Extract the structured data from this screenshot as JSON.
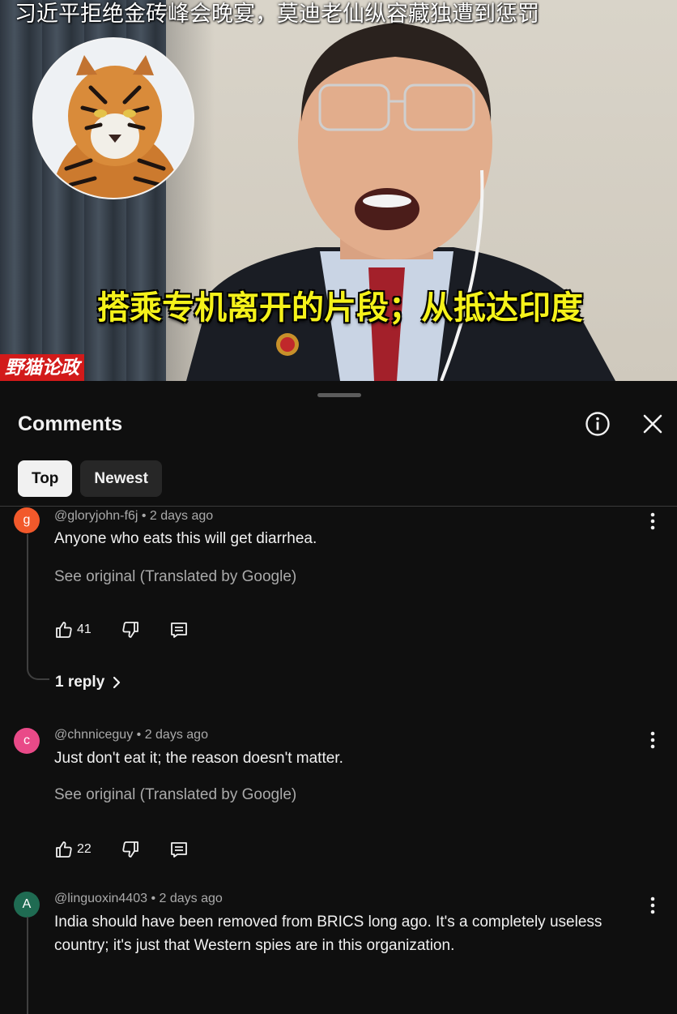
{
  "video": {
    "title": "习近平拒绝金砖峰会晚宴，莫迪老仙纵容藏独遭到惩罚",
    "subtitle": "搭乘专机离开的片段；从抵达印度",
    "channel_tag": "野猫论政",
    "avatar": "tiger-photo"
  },
  "sheet": {
    "title": "Comments",
    "info_icon": "info-icon",
    "close_icon": "close-icon",
    "chips": [
      {
        "label": "Top",
        "active": true
      },
      {
        "label": "Newest",
        "active": false
      }
    ]
  },
  "comments": [
    {
      "avatar_letter": "g",
      "avatar_color": "#f2592b",
      "author": "@gloryjohn-f6j",
      "time": "2 days ago",
      "text": "Anyone who eats this will get diarrhea.",
      "translation": "See original (Translated by Google)",
      "likes": "41",
      "replies": "1 reply"
    },
    {
      "avatar_letter": "c",
      "avatar_color": "#e94a88",
      "author": "@chnniceguy",
      "time": "2 days ago",
      "text": "Just don't eat it; the reason doesn't matter.",
      "translation": "See original (Translated by Google)",
      "likes": "22"
    },
    {
      "avatar_letter": "A",
      "avatar_color": "#1f6b52",
      "author": "@linguoxin4403",
      "time": "2 days ago",
      "text": "India should have been removed from BRICS long ago. It's a completely useless country; it's just that Western spies are in this organization."
    }
  ],
  "separator": " • "
}
